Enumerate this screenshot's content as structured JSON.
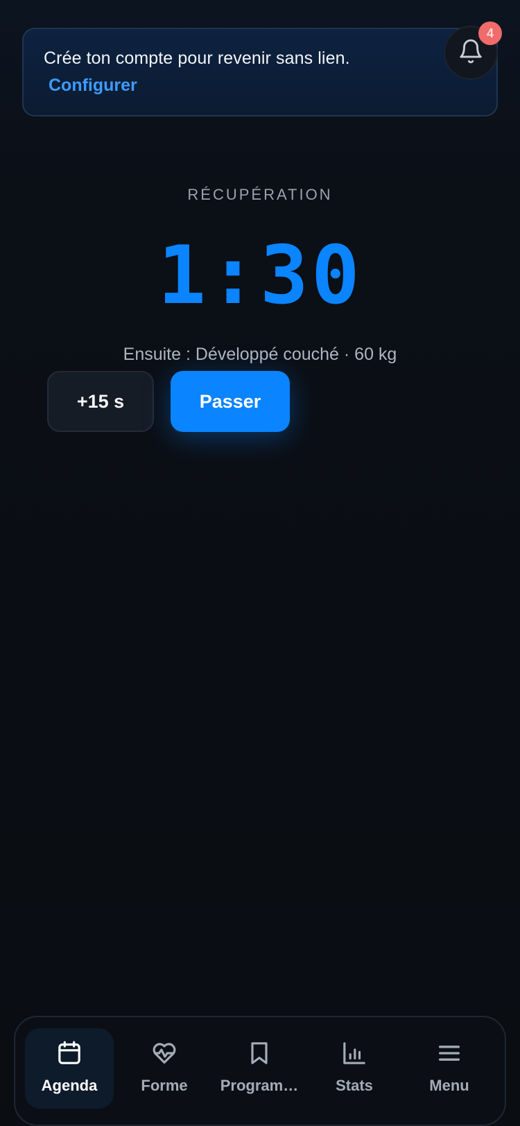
{
  "banner": {
    "message": "Crée ton compte pour revenir sans lien.",
    "link_label": "Configurer"
  },
  "notifications": {
    "icon": "bell-icon",
    "badge_count": "4",
    "badge_color": "#f06b6b"
  },
  "timer": {
    "label": "RÉCUPÉRATION",
    "value": "1:30",
    "next": "Ensuite : Développé couché · 60 kg",
    "accent_color": "#0a84ff"
  },
  "actions": {
    "add_label": "+15 s",
    "skip_label": "Passer"
  },
  "nav": {
    "active": "Agenda",
    "items": [
      {
        "label": "Agenda",
        "icon": "calendar-icon"
      },
      {
        "label": "Forme",
        "icon": "heart-pulse-icon"
      },
      {
        "label": "Program…",
        "icon": "bookmark-icon"
      },
      {
        "label": "Stats",
        "icon": "bar-chart-icon"
      },
      {
        "label": "Menu",
        "icon": "menu-icon"
      }
    ]
  }
}
